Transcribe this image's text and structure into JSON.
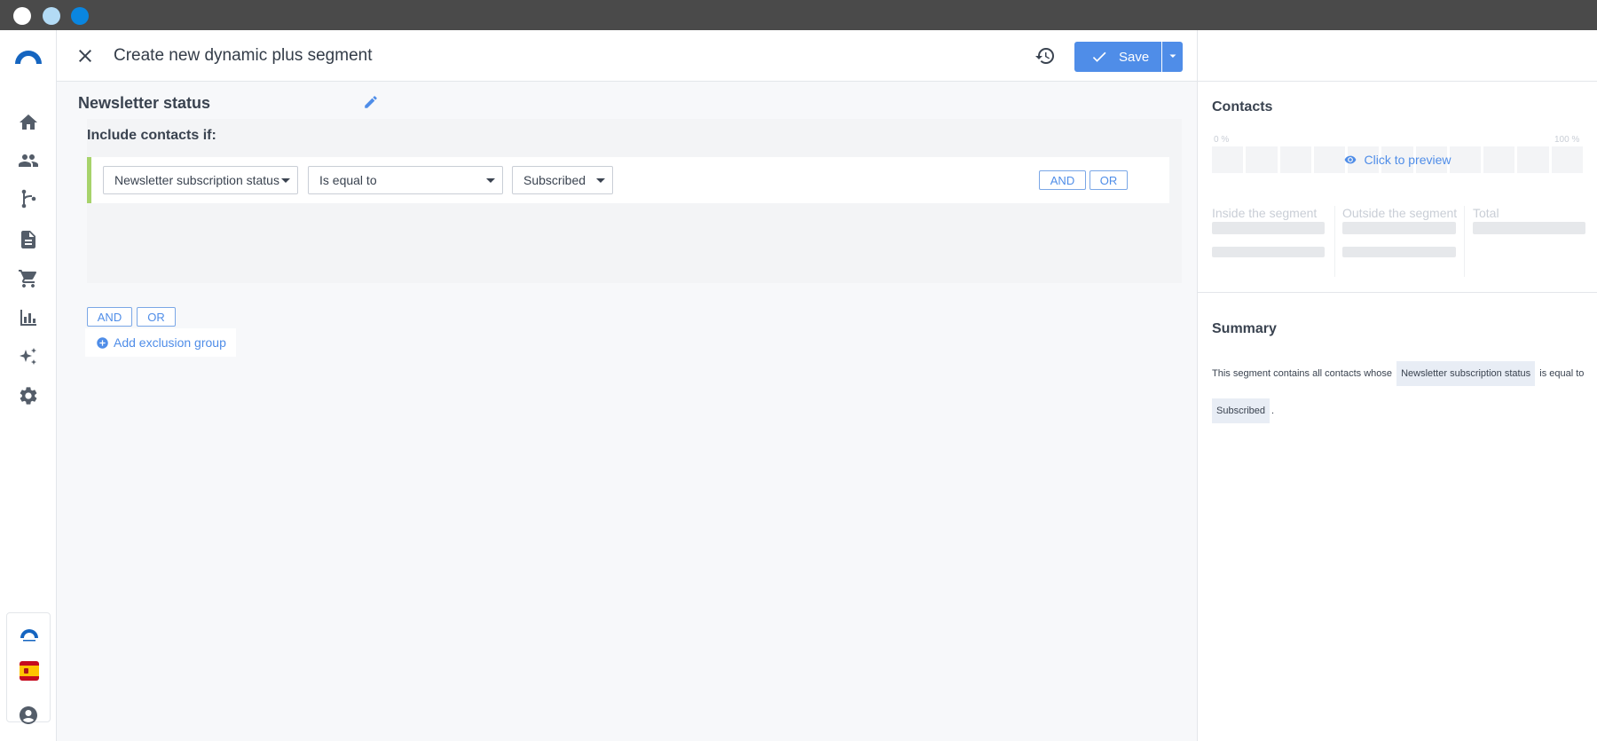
{
  "header": {
    "title": "Create new dynamic plus segment",
    "save_label": "Save"
  },
  "segment": {
    "name": "Newsletter status",
    "include_label": "Include contacts if:",
    "rule": {
      "field": "Newsletter subscription status",
      "operator": "Is equal to",
      "value": "Subscribed"
    },
    "and_label": "AND",
    "or_label": "OR",
    "add_exclusion_label": "Add exclusion group"
  },
  "panel": {
    "contacts_title": "Contacts",
    "pct_min": "0 %",
    "pct_max": "100 %",
    "preview_label": "Click to preview",
    "inside_label": "Inside the segment",
    "outside_label": "Outside the segment",
    "total_label": "Total",
    "summary_title": "Summary",
    "summary_prefix": "This segment contains all contacts whose",
    "summary_field": "Newsletter subscription status",
    "summary_operator": "is equal to",
    "summary_value": "Subscribed",
    "summary_suffix": "."
  },
  "nav": {
    "items": [
      "home-icon",
      "contacts-icon",
      "automation-icon",
      "forms-icon",
      "ecommerce-icon",
      "reports-icon",
      "ai-sparkle-icon",
      "settings-icon"
    ]
  },
  "colors": {
    "accent": "#4f8de8",
    "rule_border": "#a7d36b",
    "titlebar": "#4a4a4a"
  }
}
